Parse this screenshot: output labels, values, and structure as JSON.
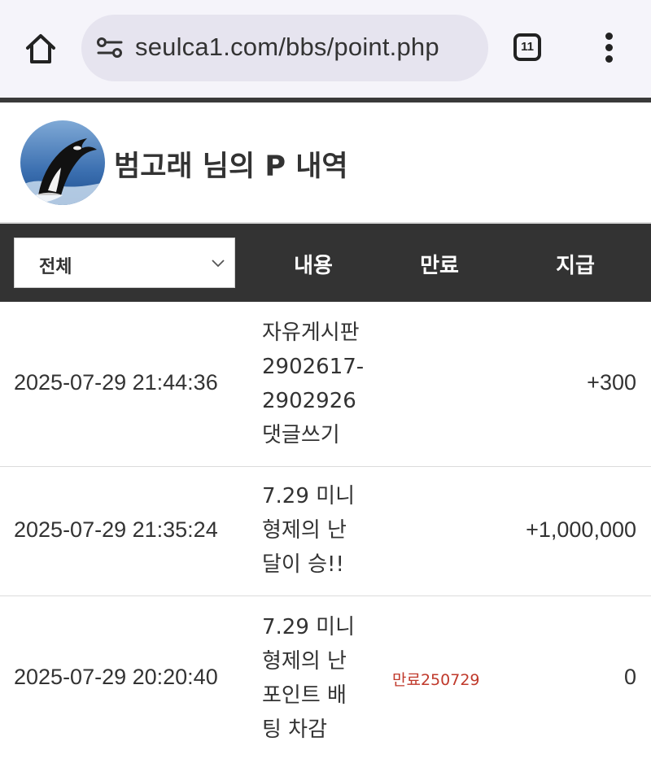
{
  "browser": {
    "url": "seulca1.com/bbs/point.php",
    "tab_count": "11"
  },
  "profile": {
    "title": "범고래 님의 P 내역"
  },
  "table": {
    "filter_value": "전체",
    "headers": {
      "content": "내용",
      "expire": "만료",
      "amount": "지급"
    },
    "rows": [
      {
        "date": "2025-07-29 21:44:36",
        "content_lines": [
          "자유게시판",
          "2902617-",
          "2902926",
          "댓글쓰기"
        ],
        "expire": "",
        "amount": "+300"
      },
      {
        "date": "2025-07-29 21:35:24",
        "content_lines": [
          "7.29 미니",
          "형제의 난",
          "달이 승!!"
        ],
        "expire": "",
        "amount": "+1,000,000"
      },
      {
        "date": "2025-07-29 20:20:40",
        "content_lines": [
          "7.29 미니",
          "형제의 난",
          "포인트 배",
          "팅 차감"
        ],
        "expire": "만료250729",
        "amount": "0"
      }
    ]
  },
  "colors": {
    "header_bg": "#333333",
    "expire_text": "#c0392b",
    "browser_bg": "#f5f4fa"
  }
}
